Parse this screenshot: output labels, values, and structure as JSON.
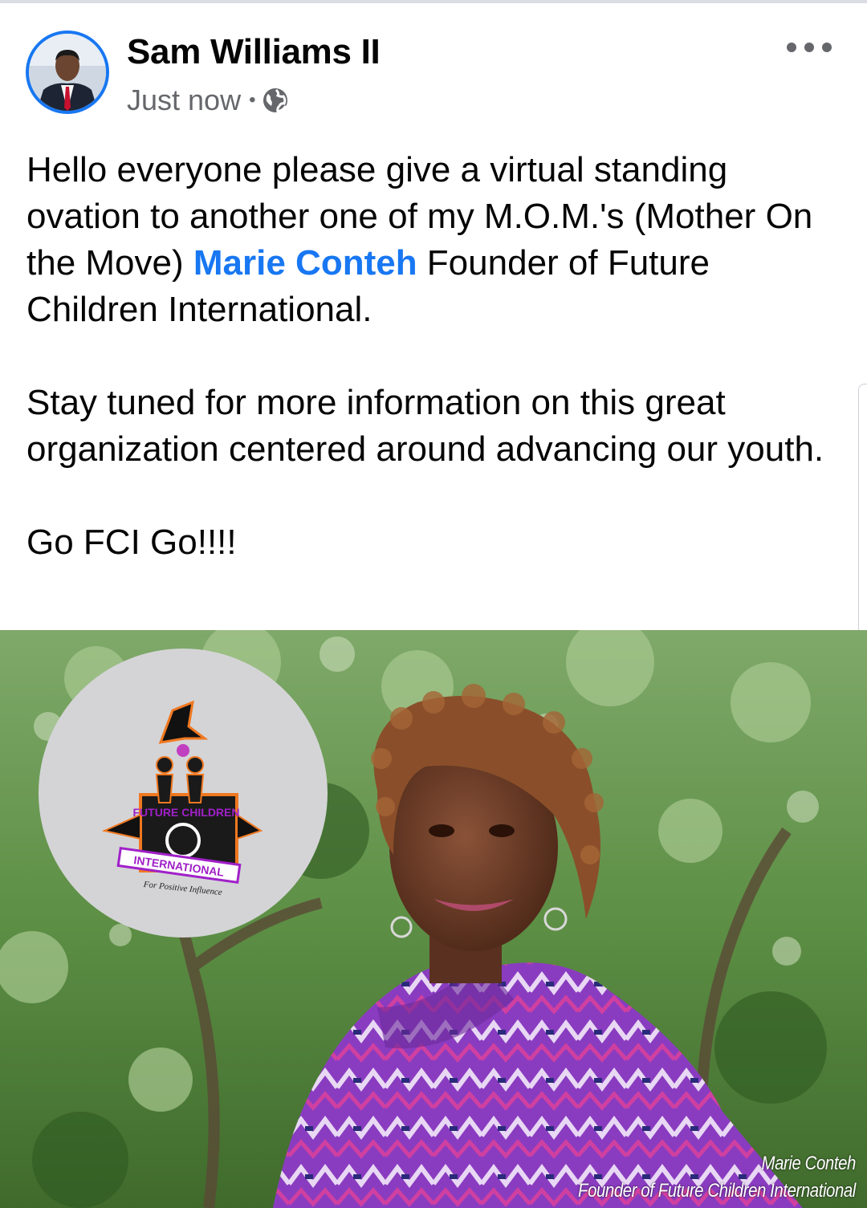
{
  "post": {
    "author": "Sam Williams II",
    "timestamp": "Just now",
    "separator": "•",
    "privacy_icon": "globe-icon",
    "more_icon": "more-options-icon",
    "paragraph1_before": "Hello everyone please give a virtual standing ovation to another one of my M.O.M.'s (Mother On the Move) ",
    "mention": "Marie Conteh",
    "paragraph1_after": " Founder of Future Children International.",
    "paragraph2": "Stay tuned for more information on this great organization centered around advancing our youth.",
    "paragraph3": "Go FCI Go!!!!"
  },
  "photo": {
    "logo_top": "FUTURE CHILDREN",
    "logo_bottom": "INTERNATIONAL",
    "logo_tagline": "For Positive Influence",
    "caption_name": "Marie Conteh",
    "caption_title": "Founder of Future Children International"
  },
  "colors": {
    "accent": "#1877f2",
    "text": "#050505",
    "secondary_text": "#65676b",
    "logo_purple": "#a020c8"
  }
}
